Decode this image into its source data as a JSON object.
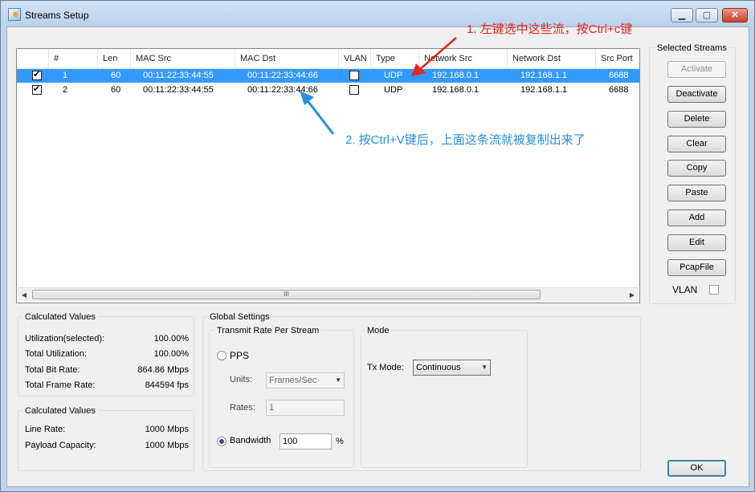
{
  "window": {
    "title": "Streams Setup",
    "minimize": "▁",
    "maximize": "▢",
    "close": "✕"
  },
  "streams": {
    "columns": [
      "#",
      "Len",
      "MAC Src",
      "MAC Dst",
      "VLAN",
      "Type",
      "Network Src",
      "Network Dst",
      "Src Port"
    ],
    "rows": [
      {
        "num": "1",
        "len": "60",
        "mac_src": "00:11:22:33:44:55",
        "mac_dst": "00:11:22:33:44:66",
        "type": "UDP",
        "net_src": "192.168.0.1",
        "net_dst": "192.168.1.1",
        "src_port": "6688",
        "selected": true
      },
      {
        "num": "2",
        "len": "60",
        "mac_src": "00:11:22:33:44:55",
        "mac_dst": "00:11:22:33:44:66",
        "type": "UDP",
        "net_src": "192.168.0.1",
        "net_dst": "192.168.1.1",
        "src_port": "6688",
        "selected": false
      }
    ],
    "scroll_grip": "III"
  },
  "selected_streams": {
    "title": "Selected Streams",
    "buttons": [
      "Activate",
      "Deactivate",
      "Delete",
      "Clear",
      "Copy",
      "Paste",
      "Add",
      "Edit",
      "PcapFile"
    ],
    "vlan_label": "VLAN"
  },
  "calculated1": {
    "title": "Calculated Values",
    "rows": [
      {
        "label": "Utilization(selected):",
        "value": "100.00%"
      },
      {
        "label": "Total Utilization:",
        "value": "100.00%"
      },
      {
        "label": "Total Bit Rate:",
        "value": "864.86 Mbps"
      },
      {
        "label": "Total Frame Rate:",
        "value": "844594 fps"
      }
    ]
  },
  "calculated2": {
    "title": "Calculated Values",
    "rows": [
      {
        "label": "Line Rate:",
        "value": "1000 Mbps"
      },
      {
        "label": "Payload Capacity:",
        "value": "1000 Mbps"
      }
    ]
  },
  "global_settings": {
    "title": "Global Settings",
    "transmit_title": "Transmit Rate Per Stream",
    "pps_label": "PPS",
    "units_label": "Units:",
    "units_value": "Frames/Sec",
    "rates_label": "Rates:",
    "rates_value": "1",
    "bandwidth_label": "Bandwidth",
    "bandwidth_value": "100",
    "percent": "%",
    "mode_title": "Mode",
    "txmode_label": "Tx Mode:",
    "txmode_value": "Continuous"
  },
  "ok_label": "OK",
  "annotations": {
    "note1": "1. 左键选中这些流，按Ctrl+c键",
    "note1_color": "#e8261c",
    "note2": "2. 按Ctrl+V键后，上面这条流就被复制出来了",
    "note2_color": "#2b8fd8"
  },
  "colors": {
    "selection": "#3399ff",
    "window_frame": "#bcd3ea"
  }
}
